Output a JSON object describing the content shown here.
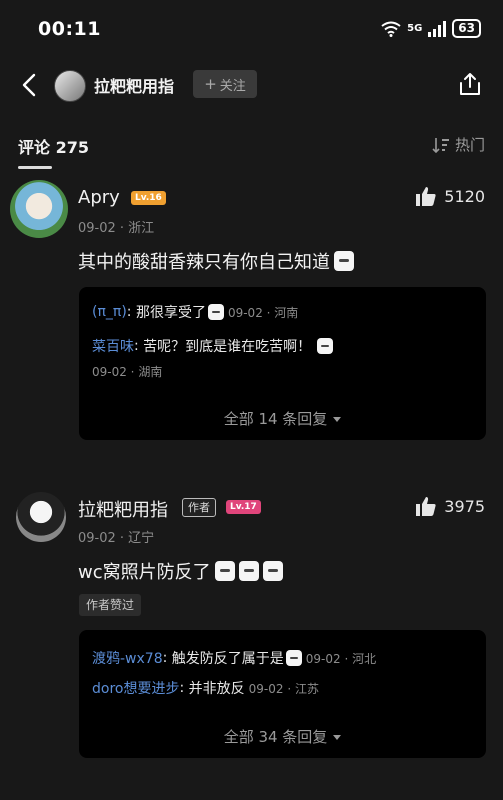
{
  "status": {
    "time": "00:11",
    "network": "5G",
    "battery": "63"
  },
  "header": {
    "username": "拉粑粑用指",
    "follow_label": "关注"
  },
  "comments_header": {
    "title": "评论 275",
    "sort_label": "热门"
  },
  "comments": [
    {
      "user": "Apry",
      "level": "Lv.16",
      "likes": "5120",
      "meta": "09-02 · 浙江",
      "text": "其中的酸甜香辣只有你自己知道",
      "replies": [
        {
          "user": "(π_π)",
          "text": "那很享受了",
          "meta": "09-02 · 河南"
        },
        {
          "user": "菜百味",
          "text": "苦呢？到底是谁在吃苦啊！",
          "meta": "09-02 · 湖南"
        }
      ],
      "all_replies": "全部 14 条回复"
    },
    {
      "user": "拉粑粑用指",
      "author_tag": "作者",
      "level": "Lv.17",
      "likes": "3975",
      "meta": "09-02 · 辽宁",
      "text": "wc窝照片防反了",
      "liked_badge": "作者赞过",
      "replies": [
        {
          "user": "渡鸦-wx78",
          "text": "触发防反了属于是",
          "meta": "09-02 · 河北"
        },
        {
          "user": "doro想要进步",
          "text": "并非放反",
          "meta": "09-02 · 江苏"
        }
      ],
      "all_replies": "全部 34 条回复"
    }
  ],
  "colors": {
    "background": "#181818",
    "reply_user": "#5b8dd6",
    "lv16": "#f0a030",
    "lv17": "#e0457b"
  }
}
